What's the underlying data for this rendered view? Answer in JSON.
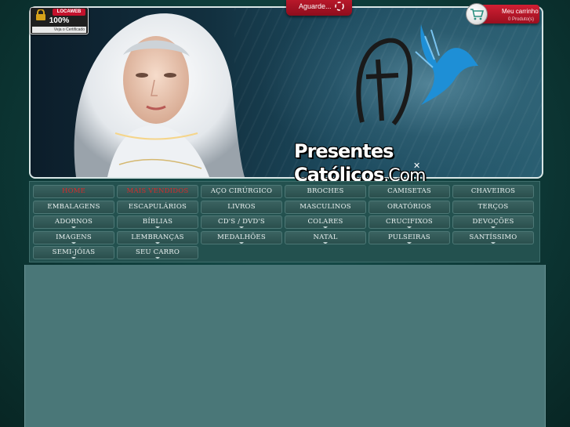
{
  "header": {
    "loading_text": "Aguarde...",
    "security_seal": {
      "brand": "LOCAWEB",
      "main": "100% SEGURO",
      "sub": "Veja o Certificado"
    },
    "cart": {
      "title": "Meu carrinho",
      "subtitle": "0 Produto(s)",
      "icon": "shopping-cart-icon"
    },
    "site_name": "Presentes Católicos",
    "site_name_suffix": ".Com",
    "logo_icon": "cross-dove-icon"
  },
  "menu": {
    "rows": [
      [
        {
          "label": "HOME",
          "active": true,
          "dropdown": false
        },
        {
          "label": "MAIS VENDIDOS",
          "active": true,
          "dropdown": false
        },
        {
          "label": "AÇO CIRÚRGICO",
          "active": false,
          "dropdown": false
        },
        {
          "label": "BROCHES",
          "active": false,
          "dropdown": false
        },
        {
          "label": "CAMISETAS",
          "active": false,
          "dropdown": false
        },
        {
          "label": "CHAVEIROS",
          "active": false,
          "dropdown": false
        }
      ],
      [
        {
          "label": "EMBALAGENS",
          "active": false,
          "dropdown": false
        },
        {
          "label": "ESCAPULÁRIOS",
          "active": false,
          "dropdown": false
        },
        {
          "label": "LIVROS",
          "active": false,
          "dropdown": false
        },
        {
          "label": "MASCULINOS",
          "active": false,
          "dropdown": false
        },
        {
          "label": "ORATÓRIOS",
          "active": false,
          "dropdown": false
        },
        {
          "label": "TERÇOS",
          "active": false,
          "dropdown": false
        }
      ],
      [
        {
          "label": "ADORNOS",
          "active": false,
          "dropdown": true
        },
        {
          "label": "BÍBLIAS",
          "active": false,
          "dropdown": true
        },
        {
          "label": "CD'S / DVD'S",
          "active": false,
          "dropdown": true
        },
        {
          "label": "COLARES",
          "active": false,
          "dropdown": true
        },
        {
          "label": "CRUCIFIXOS",
          "active": false,
          "dropdown": true
        },
        {
          "label": "DEVOÇÕES",
          "active": false,
          "dropdown": true
        }
      ],
      [
        {
          "label": "IMAGENS",
          "active": false,
          "dropdown": true
        },
        {
          "label": "LEMBRANÇAS",
          "active": false,
          "dropdown": true
        },
        {
          "label": "MEDALHÕES",
          "active": false,
          "dropdown": true
        },
        {
          "label": "NATAL",
          "active": false,
          "dropdown": true
        },
        {
          "label": "PULSEIRAS",
          "active": false,
          "dropdown": true
        },
        {
          "label": "SANTÍSSIMO",
          "active": false,
          "dropdown": true
        }
      ],
      [
        {
          "label": "SEMI-JÓIAS",
          "active": false,
          "dropdown": true
        },
        {
          "label": "SEU CARRO",
          "active": false,
          "dropdown": true
        }
      ]
    ]
  },
  "colors": {
    "accent_red": "#c4122c",
    "menu_active_text": "#d42a2a",
    "menu_bg": "#23514f",
    "content_bg": "#4a7778",
    "page_bg": "#0b3432"
  }
}
